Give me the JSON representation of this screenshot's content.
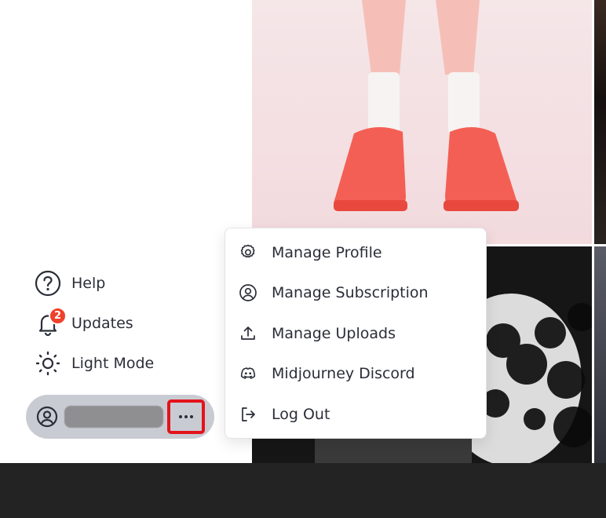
{
  "sidebar": {
    "items": [
      {
        "label": "Help",
        "icon": "help-circle-icon"
      },
      {
        "label": "Updates",
        "icon": "bell-icon",
        "badge": "2"
      },
      {
        "label": "Light Mode",
        "icon": "sun-icon"
      }
    ],
    "account": {
      "avatar_icon": "user-circle-icon",
      "more_icon": "ellipsis-icon"
    }
  },
  "menu": {
    "items": [
      {
        "label": "Manage Profile",
        "icon": "gear-icon"
      },
      {
        "label": "Manage Subscription",
        "icon": "user-circle-icon"
      },
      {
        "label": "Manage Uploads",
        "icon": "upload-icon"
      },
      {
        "label": "Midjourney Discord",
        "icon": "discord-icon"
      },
      {
        "label": "Log Out",
        "icon": "logout-icon"
      }
    ]
  },
  "colors": {
    "badge": "#f0412a",
    "highlight": "#e3131b",
    "text": "#2b2d38",
    "account_pill": "#c9cbd3"
  }
}
